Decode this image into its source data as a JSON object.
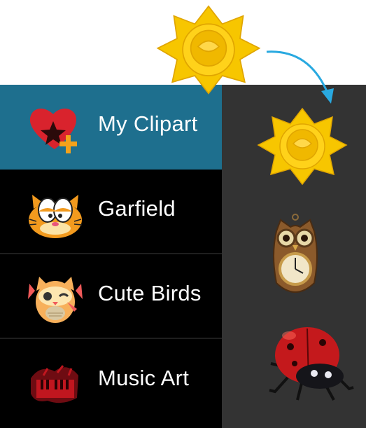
{
  "menu": {
    "items": [
      {
        "label": "My Clipart",
        "icon": "heart-star-plus-icon",
        "selected": true
      },
      {
        "label": "Garfield",
        "icon": "garfield-icon",
        "selected": false
      },
      {
        "label": "Cute Birds",
        "icon": "cute-owl-icon",
        "selected": false
      },
      {
        "label": "Music Art",
        "icon": "red-piano-icon",
        "selected": false
      }
    ]
  },
  "preview": {
    "items": [
      "yellow-flower-image",
      "owl-clock-image",
      "ladybug-image"
    ]
  },
  "drag": {
    "item": "yellow-flower-image",
    "arrow": "drag-arrow-icon"
  },
  "colors": {
    "selected_bg": "#1e6f8e",
    "menu_bg": "#000000",
    "panel_bg": "#333333",
    "arrow": "#29a9e0",
    "flower": "#f7c600"
  }
}
